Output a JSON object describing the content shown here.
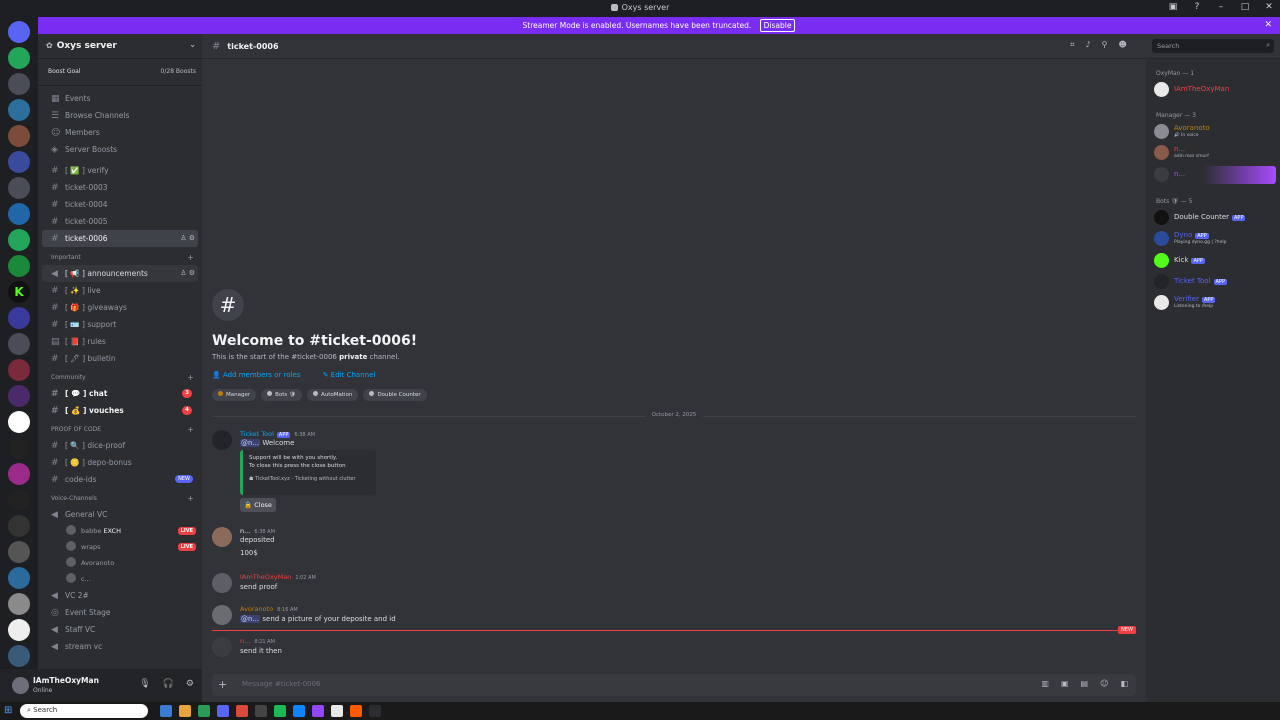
{
  "window": {
    "title": "Oxys server"
  },
  "banner": {
    "text": "Streamer Mode is enabled. Usernames have been truncated.",
    "button": "Disable"
  },
  "server": {
    "name": "Oxys server",
    "boost_goal": "Boost Goal",
    "boost_count": "0/28 Boosts"
  },
  "nav": [
    {
      "label": "Events",
      "icon": "calendar-icon"
    },
    {
      "label": "Browse Channels",
      "icon": "browse-icon"
    },
    {
      "label": "Members",
      "icon": "members-icon"
    },
    {
      "label": "Server Boosts",
      "icon": "boost-icon"
    }
  ],
  "channels_top": [
    {
      "label": "[ ✅ ] verify"
    },
    {
      "label": "ticket-0003"
    },
    {
      "label": "ticket-0004"
    },
    {
      "label": "ticket-0005"
    },
    {
      "label": "ticket-0006",
      "selected": true
    }
  ],
  "cat_important": "Important",
  "channels_important": [
    {
      "label": "[ 📢 ] announcements"
    },
    {
      "label": "[ ✨ ] live"
    },
    {
      "label": "[ 🎁 ] giveaways"
    },
    {
      "label": "[ 🪪 ] support"
    },
    {
      "label": "[ 📕 ] rules"
    },
    {
      "label": "[ 🖊 ] bulletin"
    }
  ],
  "cat_community": "Community",
  "channels_community": [
    {
      "label": "[ 💬 ] chat",
      "badge": "3"
    },
    {
      "label": "[ 💰 ] vouches",
      "badge": "4"
    }
  ],
  "cat_proof": "PROOF OF CODE",
  "channels_proof": [
    {
      "label": "[ 🔍 ] dice-proof"
    },
    {
      "label": "[ 🪙 ] depo-bonus"
    },
    {
      "label": "code-ids",
      "new": "NEW"
    }
  ],
  "cat_voice": "Voice-Channels",
  "voice": {
    "general": "General VC",
    "users": [
      {
        "name": "babbe",
        "extra": "EXCH",
        "live": "LIVE"
      },
      {
        "name": "wraps",
        "live": "LIVE"
      },
      {
        "name": "Avoranoto"
      },
      {
        "name": "c..."
      }
    ],
    "others": [
      "VC 2#",
      "Event Stage",
      "Staff VC",
      "stream vc"
    ]
  },
  "user": {
    "name": "IAmTheOxyMan",
    "status": "Online"
  },
  "channel": {
    "name": "ticket-0006",
    "welcome_title": "Welcome to #ticket-0006!",
    "welcome_desc_pre": "This is the start of the #ticket-0006",
    "welcome_desc_bold": "private",
    "welcome_desc_post": "channel.",
    "link_add": "Add members or roles",
    "link_edit": "Edit Channel"
  },
  "roles": [
    "Manager",
    "Bots 🛡",
    "AutoMation",
    "Double Counter"
  ],
  "date_divider": "October 2, 2025",
  "messages": {
    "m1": {
      "author": "Ticket Tool",
      "tag": "APP",
      "time": "6:38 AM",
      "mention": "@n...",
      "text": "Welcome",
      "embed_l1": "Support will be with you shortly.",
      "embed_l2": "To close this press the close button",
      "embed_foot": "TicketTool.xyz - Ticketing without clutter",
      "button": "🔒 Close"
    },
    "m2": {
      "author": "n...",
      "time": "6:38 AM",
      "l1": "deposited",
      "l2": "100$"
    },
    "m3": {
      "author": "IAmTheOxyMan",
      "time": "1:02 AM",
      "text": "send proof"
    },
    "m4": {
      "author": "Avoranoto",
      "time": "8:16 AM",
      "mention": "@n...",
      "text": "send a picture of your deposite and id"
    },
    "m5": {
      "author": "n...",
      "time": "8:21 AM",
      "text": "send it then"
    }
  },
  "new_marker": "NEW",
  "composer": {
    "placeholder": "Message #ticket-0006"
  },
  "search": {
    "placeholder": "Search"
  },
  "members": {
    "oxyman_head": "OxyMan — 1",
    "oxyman": [
      {
        "name": "IAmTheOxyMan",
        "color": "#f23f43"
      }
    ],
    "manager_head": "Manager — 3",
    "manager": [
      {
        "name": "Avoranoto",
        "sub": "🔊 In voice",
        "color": "#c27c0e"
      },
      {
        "name": "n...",
        "sub": "adin ross smurf",
        "color": "#f23f43"
      },
      {
        "name": "n...",
        "sub": "",
        "color": "#a84bff"
      }
    ],
    "bots_head": "Bots 🛡 — 5",
    "bots": [
      {
        "name": "Double Counter",
        "tag": "APP",
        "sub": "",
        "color": "#dbdee1"
      },
      {
        "name": "Dyno",
        "tag": "APP",
        "sub": "Playing dyno.gg | ?help",
        "color": "#5865f2"
      },
      {
        "name": "Kick",
        "tag": "APP",
        "sub": "",
        "color": "#dbdee1"
      },
      {
        "name": "Ticket Tool",
        "tag": "APP",
        "sub": "",
        "color": "#5865f2"
      },
      {
        "name": "Verifier",
        "tag": "APP",
        "sub": "Listening to /help",
        "color": "#5865f2"
      }
    ]
  },
  "taskbar": {
    "search": "Search"
  }
}
